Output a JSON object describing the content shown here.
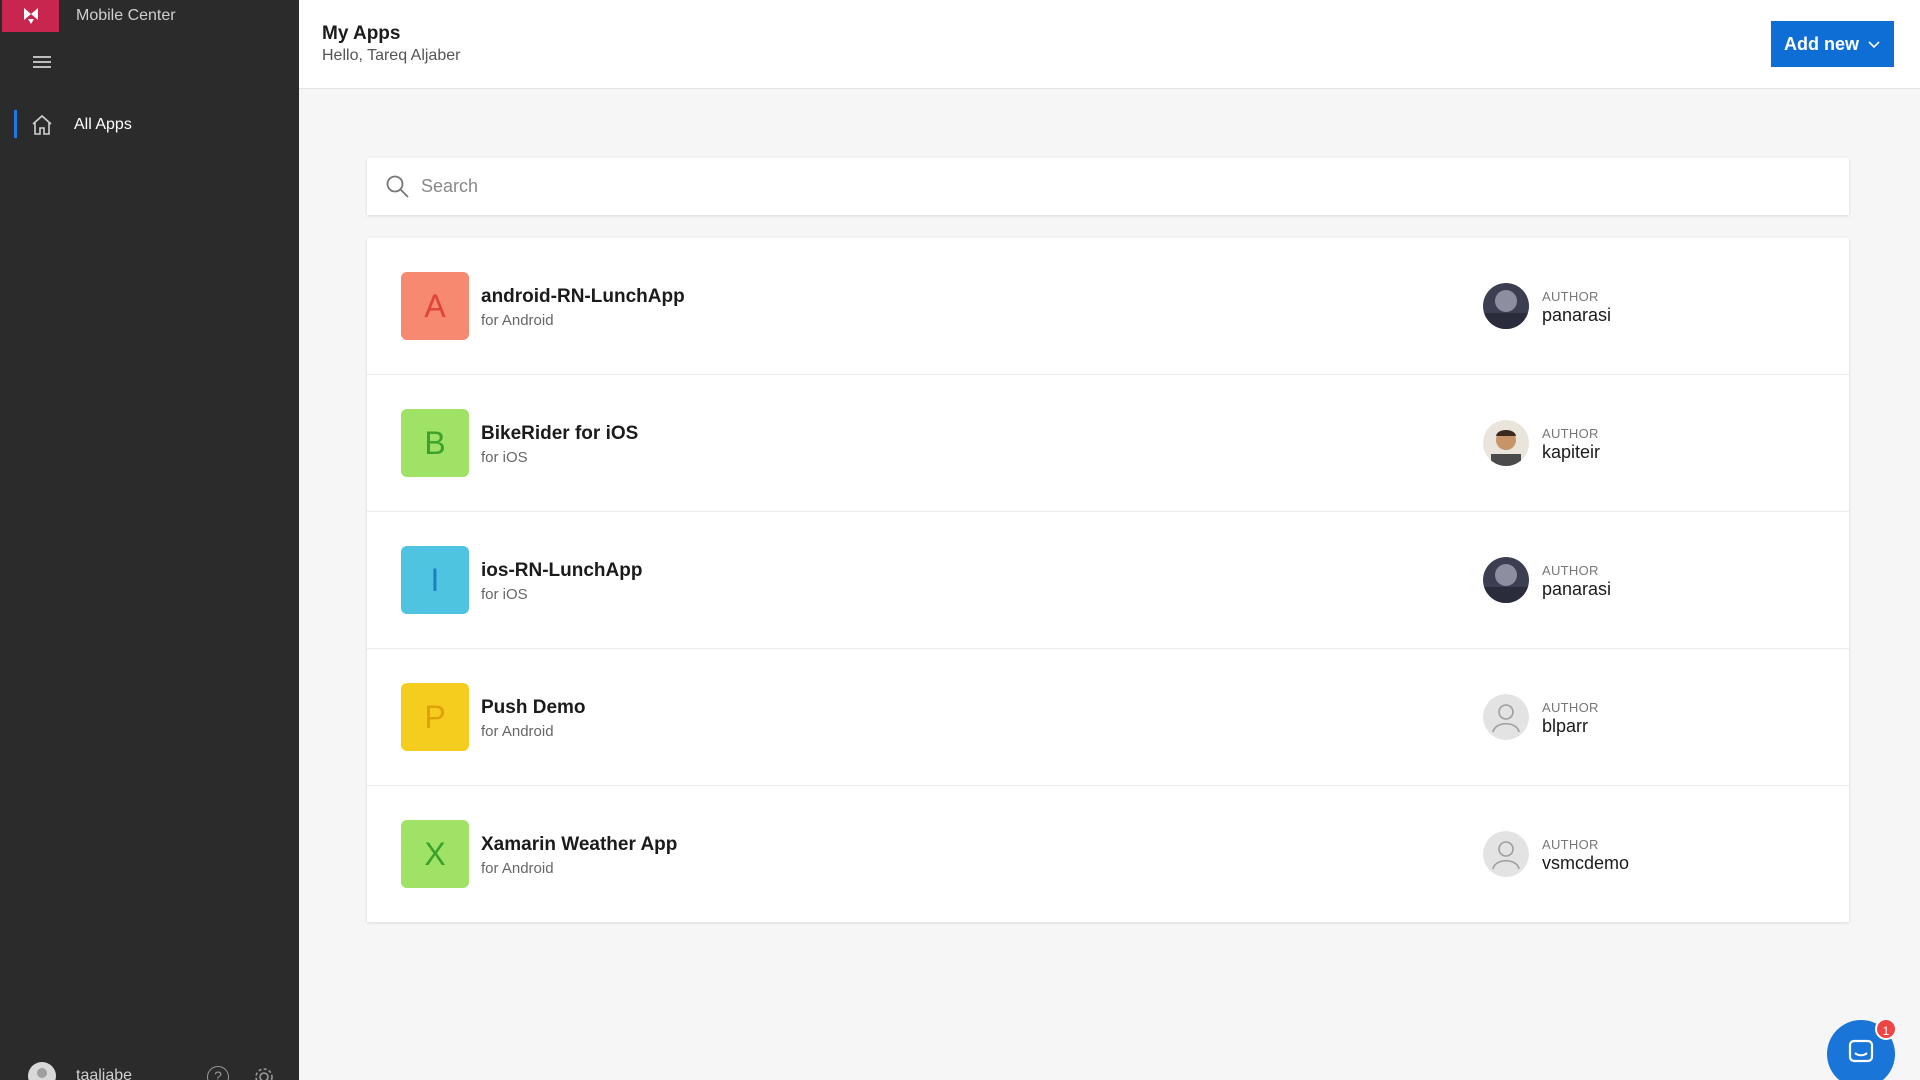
{
  "app": {
    "name": "Mobile Center"
  },
  "sidebar": {
    "items": [
      {
        "label": "All Apps",
        "icon": "home-icon"
      }
    ],
    "user": {
      "name": "taaljabe"
    }
  },
  "header": {
    "title": "My Apps",
    "greeting": "Hello, Tareq Aljaber",
    "add_label": "Add new"
  },
  "search": {
    "placeholder": "Search",
    "value": ""
  },
  "apps": [
    {
      "letter": "A",
      "name": "android-RN-LunchApp",
      "platform": "for Android",
      "author_label": "AUTHOR",
      "author": "panarasi",
      "icon_bg": "#f6896f",
      "icon_fg": "#e0433a",
      "avatar": "photo"
    },
    {
      "letter": "B",
      "name": "BikeRider for iOS",
      "platform": "for iOS",
      "author_label": "AUTHOR",
      "author": "kapiteir",
      "icon_bg": "#9fe266",
      "icon_fg": "#3aa12b",
      "avatar": "photo"
    },
    {
      "letter": "I",
      "name": "ios-RN-LunchApp",
      "platform": "for iOS",
      "author_label": "AUTHOR",
      "author": "panarasi",
      "icon_bg": "#4ec4e0",
      "icon_fg": "#1d7fbf",
      "avatar": "photo"
    },
    {
      "letter": "P",
      "name": "Push Demo",
      "platform": "for Android",
      "author_label": "AUTHOR",
      "author": "blparr",
      "icon_bg": "#f5cd1f",
      "icon_fg": "#e0a20a",
      "avatar": "placeholder"
    },
    {
      "letter": "X",
      "name": "Xamarin Weather App",
      "platform": "for Android",
      "author_label": "AUTHOR",
      "author": "vsmcdemo",
      "icon_bg": "#9fe266",
      "icon_fg": "#3aa12b",
      "avatar": "placeholder"
    }
  ],
  "chat": {
    "badge": "1"
  },
  "colors": {
    "accent": "#0e6ed6",
    "brand": "#c8254f",
    "sidebar": "#2b2b2b"
  }
}
